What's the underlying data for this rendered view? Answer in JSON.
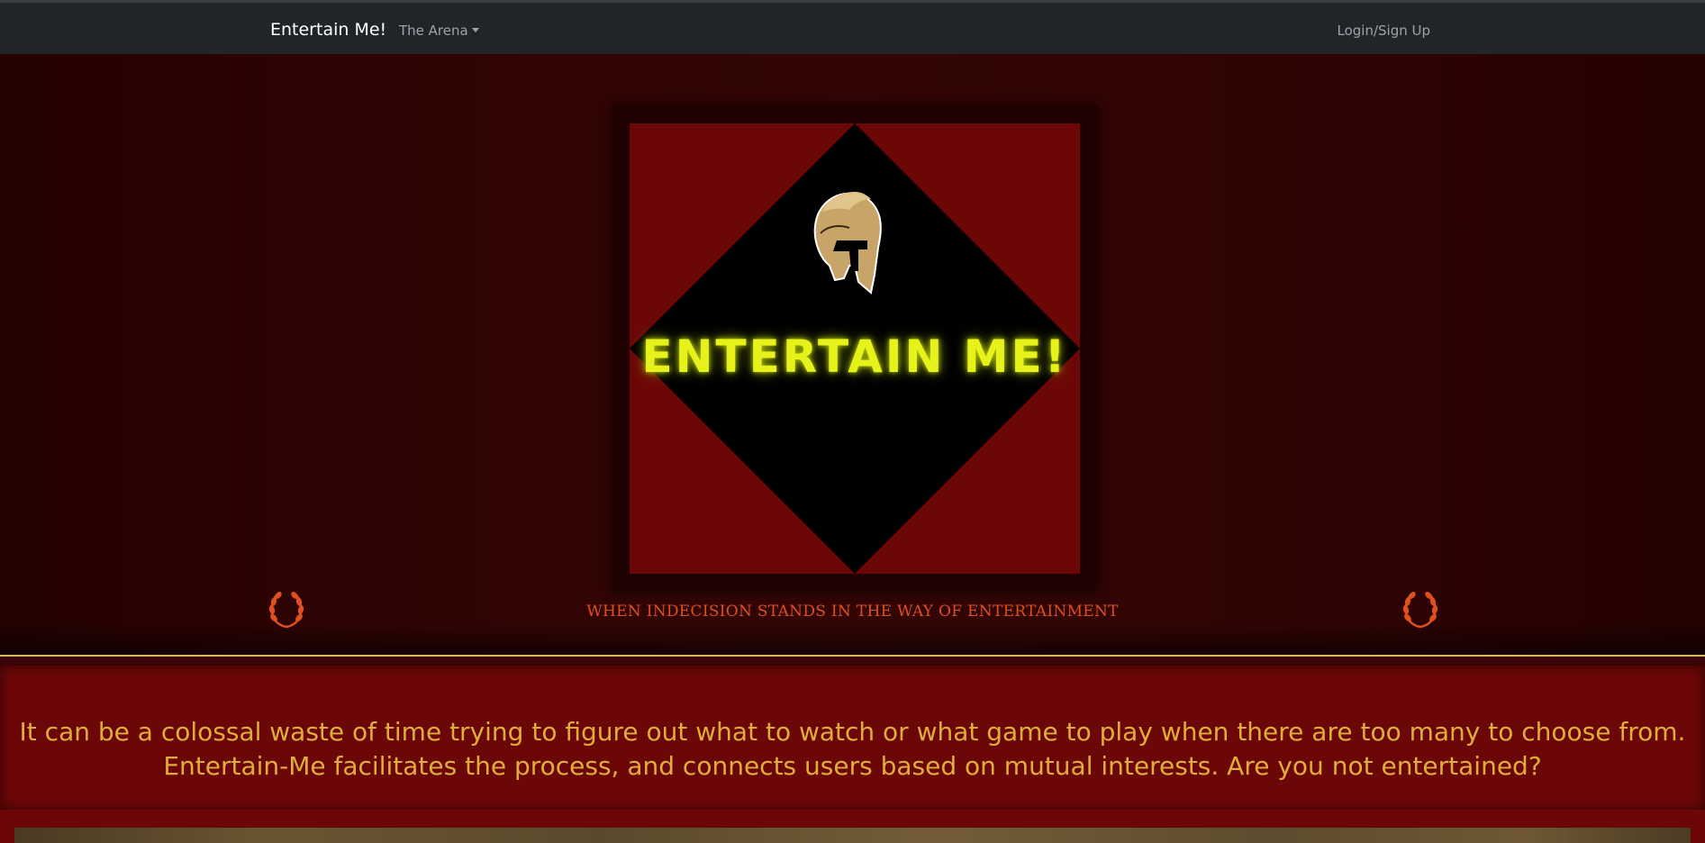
{
  "navbar": {
    "brand": "Entertain Me!",
    "dropdown_label": "The Arena",
    "login_label": "Login/Sign Up",
    "background": "#212529"
  },
  "hero": {
    "logo_text": "ENTERTAIN ME!",
    "tagline": "WHEN INDECISION STANDS IN THE WAY OF ENTERTAINMENT",
    "colors": {
      "logo_red": "#6c0707",
      "diamond": "#000000",
      "neon": "#e6f21a",
      "tagline": "#e0501f",
      "helmet_gold": "#c9a468"
    },
    "icons": [
      "spartan-helmet-icon",
      "laurel-wreath-icon"
    ]
  },
  "about": {
    "text": "It can be a colossal waste of time trying to figure out what to watch or what game to play when there are too many to choose from. Entertain-Me facilitates the process, and connects users based on mutual interests. Are you not entertained?",
    "text_color": "#e0ad3a",
    "background": "#6c0707"
  }
}
